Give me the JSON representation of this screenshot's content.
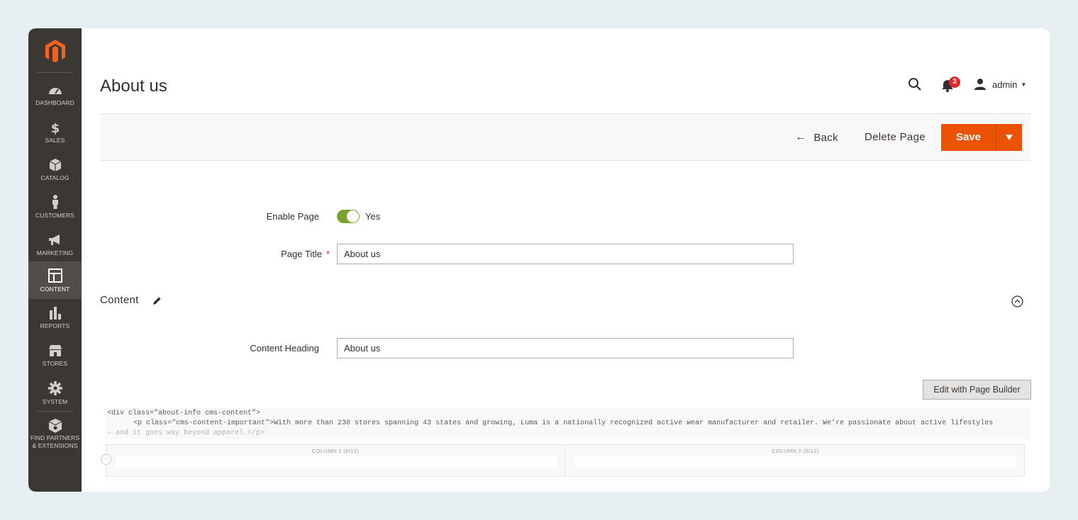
{
  "sidebar": {
    "items": [
      {
        "label": "DASHBOARD",
        "icon": "dashboard-gauge-icon"
      },
      {
        "label": "SALES",
        "icon": "dollar-icon"
      },
      {
        "label": "CATALOG",
        "icon": "cube-icon"
      },
      {
        "label": "CUSTOMERS",
        "icon": "person-icon"
      },
      {
        "label": "MARKETING",
        "icon": "megaphone-icon"
      },
      {
        "label": "CONTENT",
        "icon": "layout-icon",
        "active": true
      },
      {
        "label": "REPORTS",
        "icon": "bar-chart-icon"
      },
      {
        "label": "STORES",
        "icon": "storefront-icon"
      },
      {
        "label": "SYSTEM",
        "icon": "gear-icon"
      },
      {
        "label": "FIND PARTNERS\n& EXTENSIONS",
        "label_line1": "FIND PARTNERS",
        "label_line2": "& EXTENSIONS",
        "icon": "box-icon"
      }
    ]
  },
  "header": {
    "title": "About us",
    "notifications_count": "3",
    "user": "admin"
  },
  "actions": {
    "back": "Back",
    "delete": "Delete Page",
    "save": "Save"
  },
  "form": {
    "enable_page_label": "Enable Page",
    "enable_page_value": "Yes",
    "enable_page_on": true,
    "page_title_label": "Page Title",
    "page_title_required": "*",
    "page_title_value": "About us"
  },
  "content_section": {
    "title": "Content",
    "heading_label": "Content Heading",
    "heading_value": "About us",
    "page_builder_button": "Edit with Page Builder",
    "code_line1": "<div class=\"about-info cms-content\">",
    "code_line2": "<p class=\"cms-content-important\">With more than 230 stores spanning 43 states and growing, Luma is a nationally recognized active wear manufacturer and retailer. We're passionate about active lifestyles",
    "code_line3": "– and it goes way beyond apparel.</p>",
    "columns": [
      "COLUMN 1 (6/12)",
      "COLUMN 2 (6/12)"
    ]
  },
  "colors": {
    "accent": "#eb5202",
    "sidebar": "#3b3733",
    "toggle_on": "#79a22e",
    "badge": "#e22626"
  }
}
